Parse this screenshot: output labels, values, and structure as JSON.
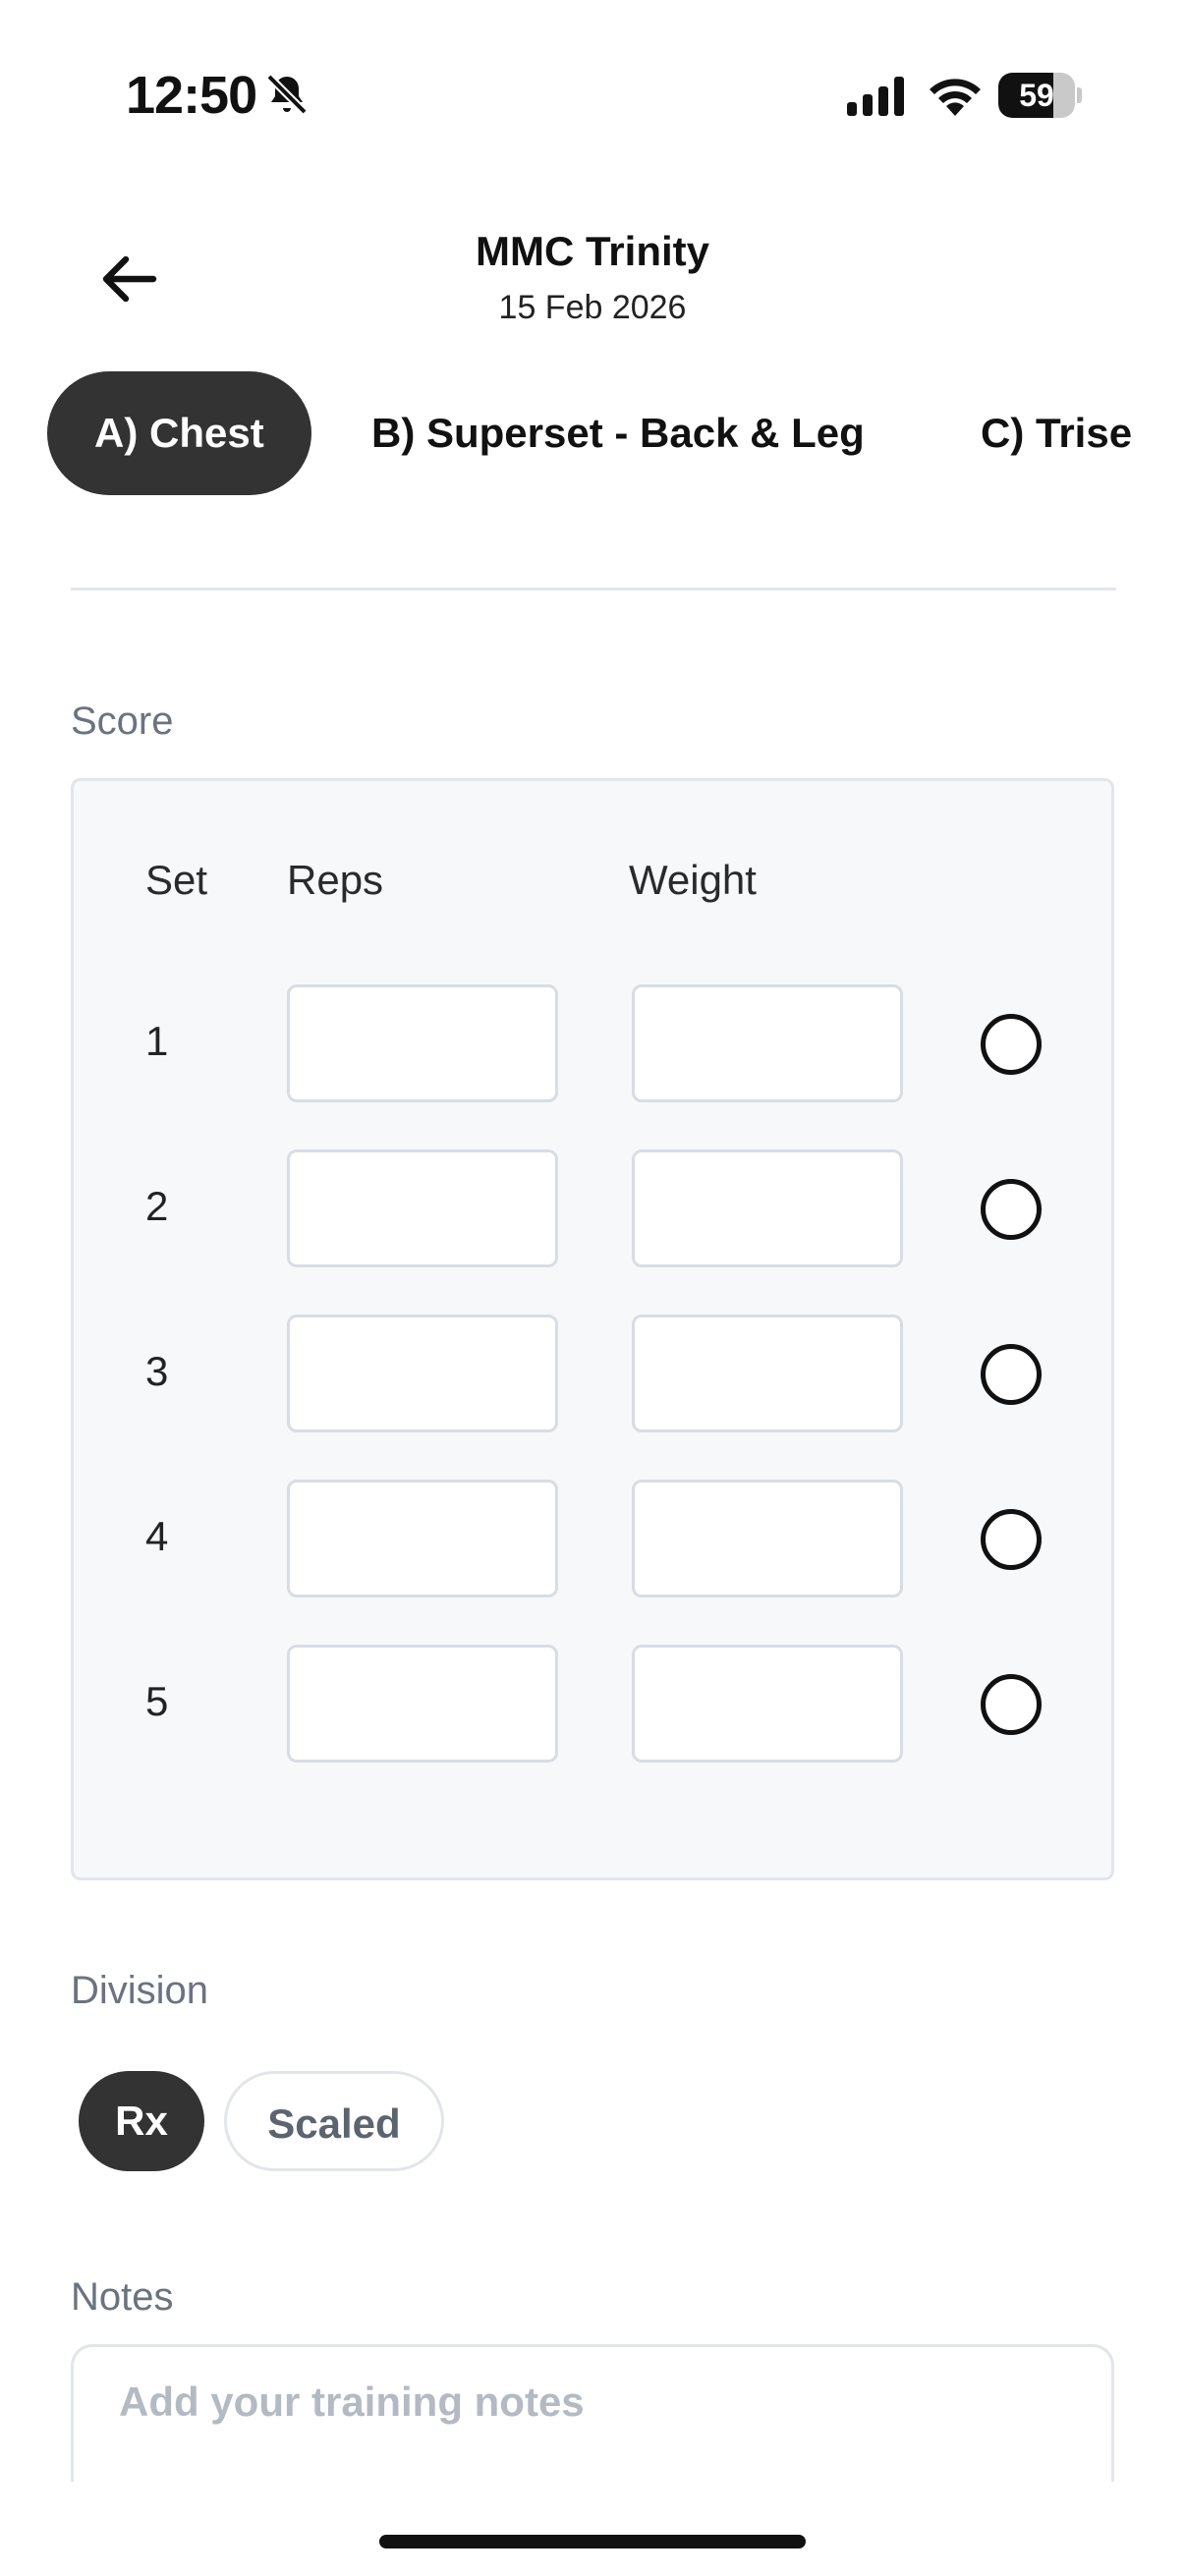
{
  "status_bar": {
    "time": "12:50",
    "battery": "59",
    "silent_icon": "bell-slash-icon",
    "signal_icon": "signal-icon",
    "wifi_icon": "wifi-icon"
  },
  "header": {
    "back_icon": "arrow-left-icon",
    "title": "MMC Trinity",
    "date": "15 Feb 2026"
  },
  "tabs": [
    {
      "label": "A) Chest",
      "active": true
    },
    {
      "label": "B) Superset - Back & Leg",
      "active": false
    },
    {
      "label": "C) Trise",
      "active": false
    }
  ],
  "score": {
    "label": "Score",
    "columns": {
      "set": "Set",
      "reps": "Reps",
      "weight": "Weight"
    },
    "rows": [
      {
        "set": "1",
        "reps": "",
        "weight": "",
        "completed": false
      },
      {
        "set": "2",
        "reps": "",
        "weight": "",
        "completed": false
      },
      {
        "set": "3",
        "reps": "",
        "weight": "",
        "completed": false
      },
      {
        "set": "4",
        "reps": "",
        "weight": "",
        "completed": false
      },
      {
        "set": "5",
        "reps": "",
        "weight": "",
        "completed": false
      }
    ]
  },
  "division": {
    "label": "Division",
    "options": [
      "Rx",
      "Scaled"
    ],
    "selected": "Rx"
  },
  "notes": {
    "label": "Notes",
    "placeholder": "Add your training notes",
    "value": ""
  },
  "colors": {
    "active_pill": "#333333",
    "label_gray": "#6b7280",
    "card_bg": "#f7f8fa",
    "border": "#e2e5ea"
  }
}
